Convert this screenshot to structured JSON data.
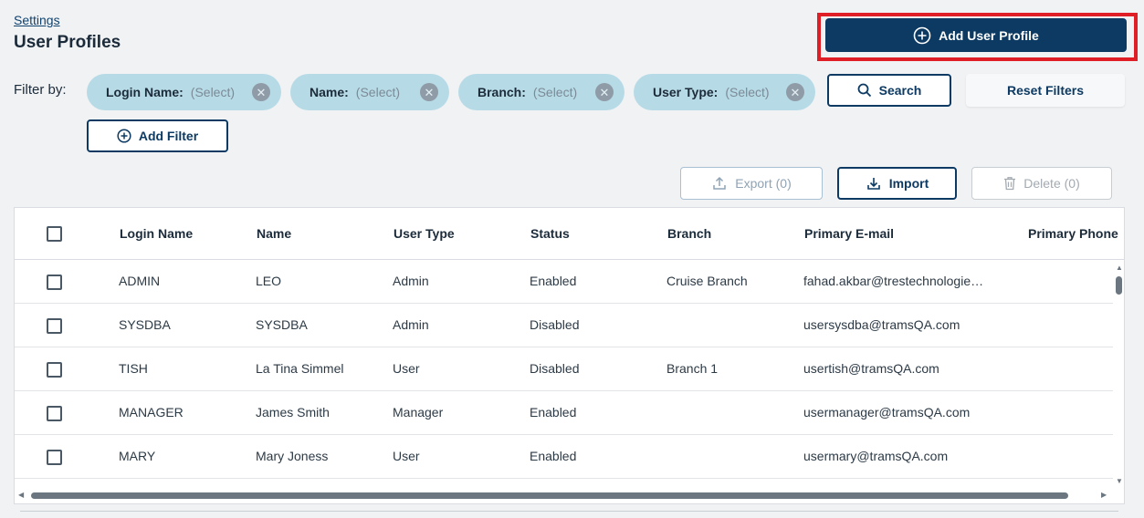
{
  "breadcrumb": "Settings",
  "page_title": "User Profiles",
  "add_user_button": "Add User Profile",
  "filter_label": "Filter by:",
  "filters": [
    {
      "name": "Login Name:",
      "value": "(Select)"
    },
    {
      "name": "Name:",
      "value": "(Select)"
    },
    {
      "name": "Branch:",
      "value": "(Select)"
    },
    {
      "name": "User Type:",
      "value": "(Select)"
    }
  ],
  "search_button": "Search",
  "reset_button": "Reset Filters",
  "add_filter_button": "Add Filter",
  "export_button": "Export (0)",
  "import_button": "Import",
  "delete_button": "Delete (0)",
  "columns": [
    "Login Name",
    "Name",
    "User Type",
    "Status",
    "Branch",
    "Primary E-mail",
    "Primary Phone"
  ],
  "rows": [
    {
      "login": "ADMIN",
      "name": "LEO",
      "type": "Admin",
      "status": "Enabled",
      "branch": "Cruise Branch",
      "email": "fahad.akbar@trestechnologie…",
      "phone": ""
    },
    {
      "login": "SYSDBA",
      "name": "SYSDBA",
      "type": "Admin",
      "status": "Disabled",
      "branch": "",
      "email": "usersysdba@tramsQA.com",
      "phone": ""
    },
    {
      "login": "TISH",
      "name": "La Tina Simmel",
      "type": "User",
      "status": "Disabled",
      "branch": "Branch 1",
      "email": "usertish@tramsQA.com",
      "phone": ""
    },
    {
      "login": "MANAGER",
      "name": "James Smith",
      "type": "Manager",
      "status": "Enabled",
      "branch": "",
      "email": "usermanager@tramsQA.com",
      "phone": ""
    },
    {
      "login": "MARY",
      "name": "Mary Joness",
      "type": "User",
      "status": "Enabled",
      "branch": "",
      "email": "usermary@tramsQA.com",
      "phone": ""
    }
  ],
  "icons": {
    "add": "plus-circle-icon",
    "clear": "close-icon",
    "search": "search-icon",
    "export": "upload-icon",
    "import": "download-icon",
    "delete": "trash-icon"
  },
  "colors": {
    "primary": "#0d3a63",
    "chip": "#b7dbe6",
    "highlight": "#e01e26"
  }
}
